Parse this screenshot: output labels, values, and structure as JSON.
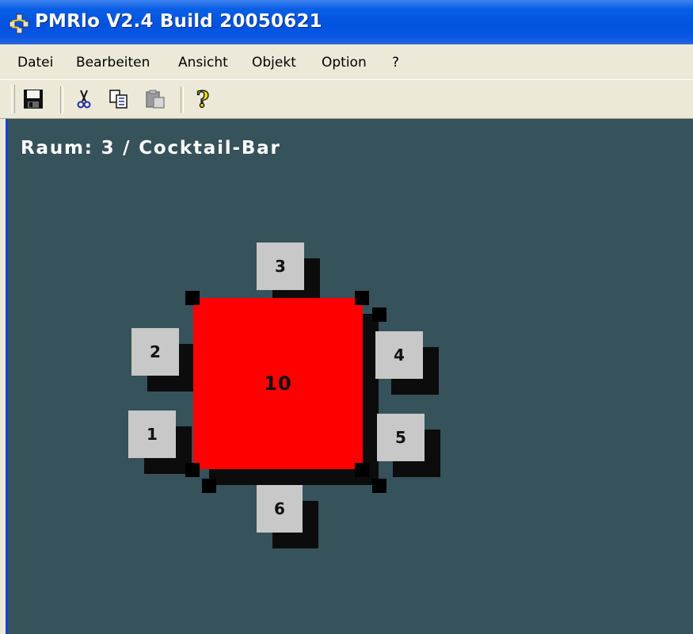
{
  "window": {
    "title": "PMRlo V2.4 Build 20050621",
    "icon": "app-network-icon"
  },
  "menu": {
    "items": [
      {
        "label": "Datei"
      },
      {
        "label": "Bearbeiten"
      },
      {
        "label": "Ansicht"
      },
      {
        "label": "Objekt"
      },
      {
        "label": "Option"
      },
      {
        "label": "?"
      }
    ]
  },
  "toolbar": {
    "buttons": [
      {
        "icon": "save-icon"
      },
      {
        "icon": "cut-icon"
      },
      {
        "icon": "copy-icon"
      },
      {
        "icon": "paste-icon"
      },
      {
        "icon": "help-icon"
      }
    ]
  },
  "room": {
    "title": "Raum: 3 / Cocktail-Bar",
    "table": {
      "label": "10",
      "color": "#ff0000"
    },
    "seats": [
      {
        "label": "3"
      },
      {
        "label": "2"
      },
      {
        "label": "4"
      },
      {
        "label": "1"
      },
      {
        "label": "5"
      },
      {
        "label": "6"
      }
    ]
  },
  "colors": {
    "canvas_bg": "#36525a",
    "seat": "#c8c8c8",
    "titlebar": "#0252de"
  }
}
